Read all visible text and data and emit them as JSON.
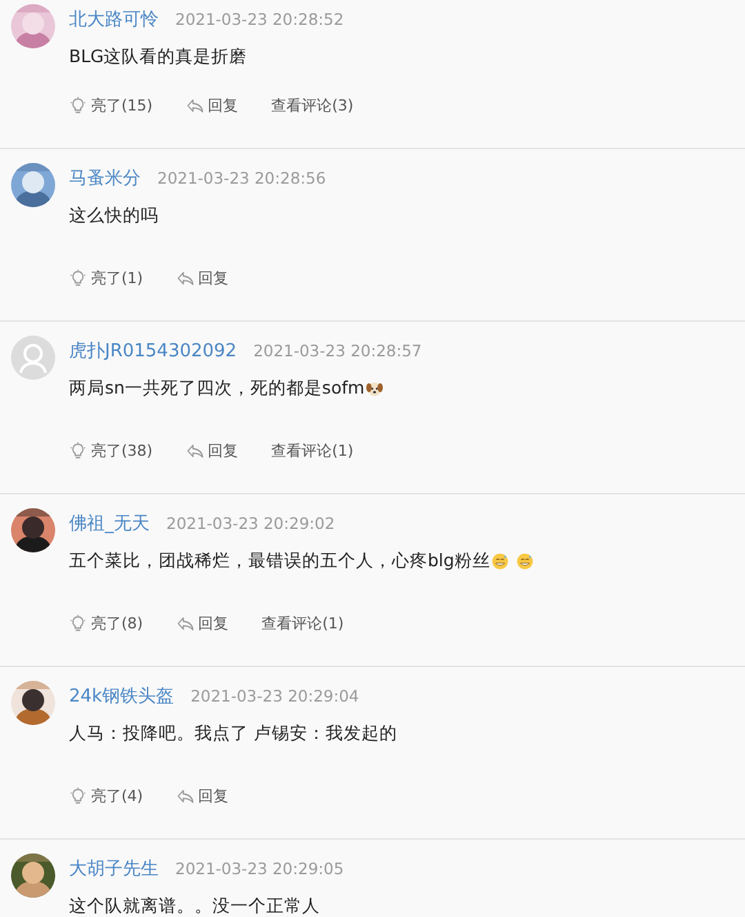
{
  "comments": [
    {
      "user": "北大路可怜",
      "time": "2021-03-23 20:28:52",
      "body": "BLG这队看的真是折磨",
      "actions": {
        "like": "亮了(15)",
        "reply": "回复",
        "view": "查看评论(3)"
      }
    },
    {
      "user": "马蚤米分",
      "time": "2021-03-23 20:28:56",
      "body": "这么快的吗",
      "actions": {
        "like": "亮了(1)",
        "reply": "回复"
      }
    },
    {
      "user": "虎扑JR0154302092",
      "time": "2021-03-23 20:28:57",
      "avatar": {
        "kind": "default"
      },
      "body": "两局sn一共死了四次，死的都是sofm",
      "emoji": [
        {
          "kind": "dog"
        }
      ],
      "actions": {
        "like": "亮了(38)",
        "reply": "回复",
        "view": "查看评论(1)"
      }
    },
    {
      "user": "佛祖_无天",
      "time": "2021-03-23 20:29:02",
      "body": "五个菜比，团战稀烂，最错误的五个人，心疼blg粉丝",
      "emoji": [
        {
          "kind": "sweat-smile"
        },
        {
          "kind": "sweat-smile"
        }
      ],
      "actions": {
        "like": "亮了(8)",
        "reply": "回复",
        "view": "查看评论(1)"
      }
    },
    {
      "user": "24k钢铁头盔",
      "time": "2021-03-23 20:29:04",
      "body": "人马：投降吧。我点了 卢锡安：我发起的",
      "actions": {
        "like": "亮了(4)",
        "reply": "回复"
      }
    },
    {
      "user": "大胡子先生",
      "time": "2021-03-23 20:29:05",
      "body": "这个队就离谱。。没一个正常人"
    }
  ]
}
